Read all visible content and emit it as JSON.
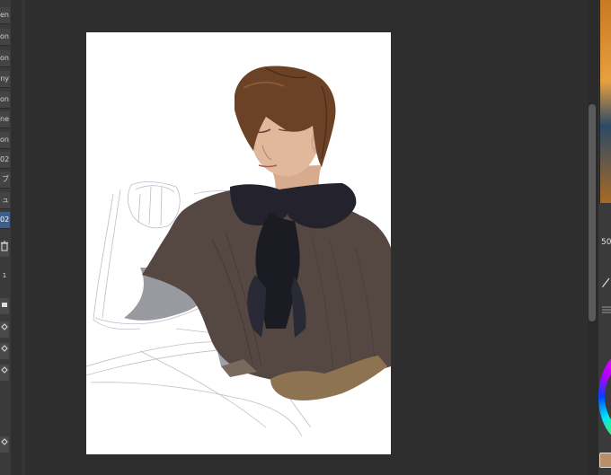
{
  "layers": [
    {
      "text": "en"
    },
    {
      "text": "on"
    },
    {
      "text": "on"
    },
    {
      "text": "ny"
    },
    {
      "text": "on"
    },
    {
      "text": "ne"
    },
    {
      "text": "on"
    },
    {
      "text": "02"
    },
    {
      "text": "ブ"
    },
    {
      "text": "ュ"
    },
    {
      "text": "02",
      "selected": true
    }
  ],
  "left_tools": {
    "trash_icon": "trash-icon",
    "mid_label": "1",
    "mid_label_2": "12"
  },
  "right_panel": {
    "size_value": "50",
    "pen_icon": "pen-icon",
    "menu_icon": "menu-icon"
  },
  "colors": {
    "ui_bg": "#2f2f2f",
    "panel_bg": "#3a3a3a",
    "selected_layer": "#3e5f8a",
    "canvas": "#ffffff",
    "hair": "#6b4226",
    "sweater": "#5a4e48",
    "bow": "#1d1d26"
  }
}
